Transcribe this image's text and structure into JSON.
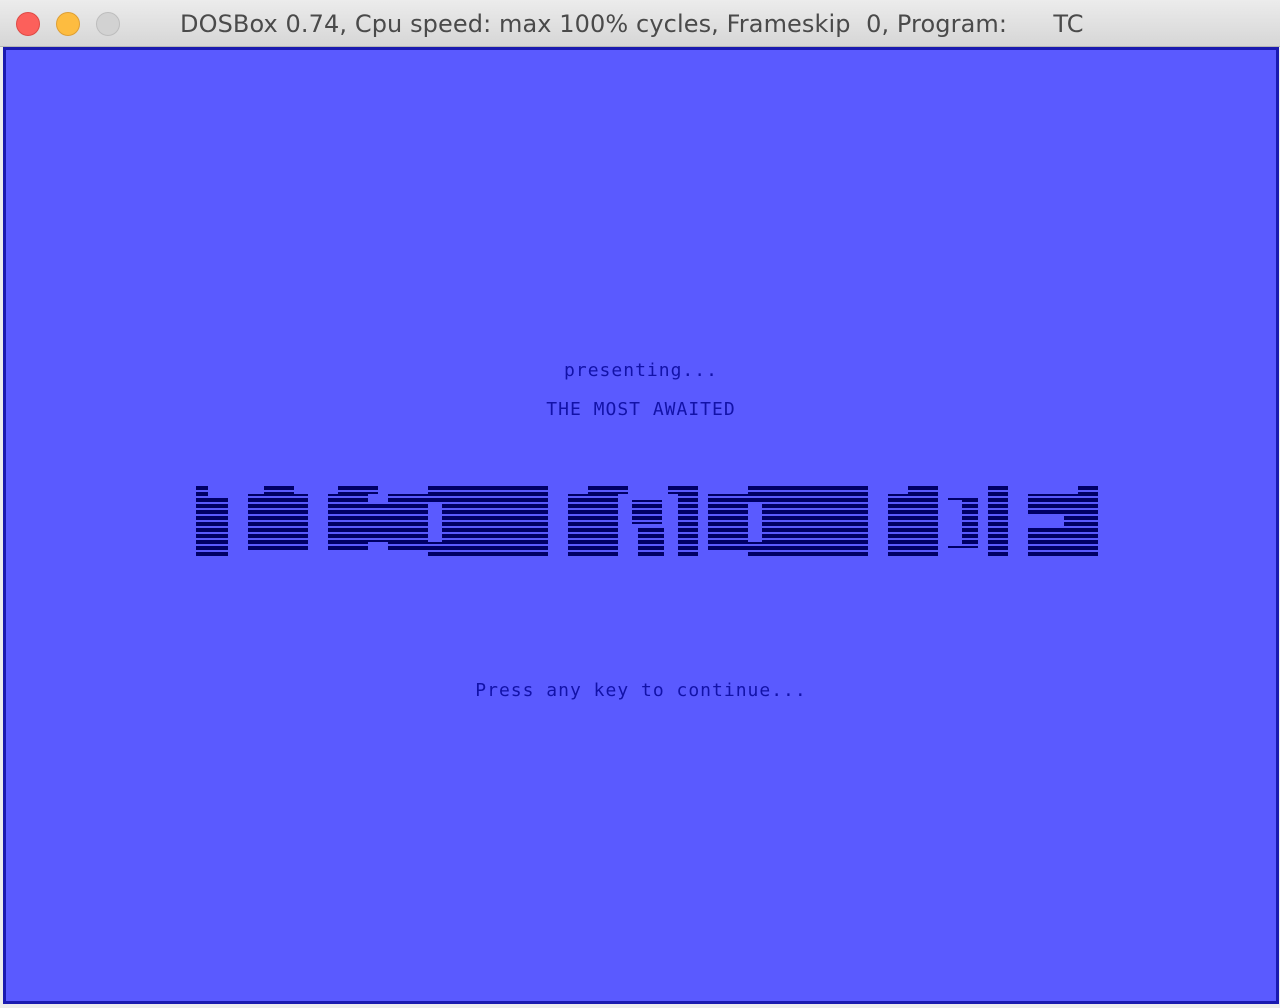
{
  "window": {
    "title": "DOSBox 0.74, Cpu speed: max 100% cycles, Frameskip  0, Program:      TC"
  },
  "screen": {
    "presenting": "presenting...",
    "subtitle": "THE MOST AWAITED",
    "prompt": "Press any key to continue...",
    "logo_label": "",
    "background_color": "#5a5aff",
    "text_color": "#1212a8",
    "logo_color": "#000066"
  },
  "icons": {
    "close": "close-button-icon",
    "minimize": "minimize-button-icon",
    "zoom": "zoom-button-icon"
  }
}
